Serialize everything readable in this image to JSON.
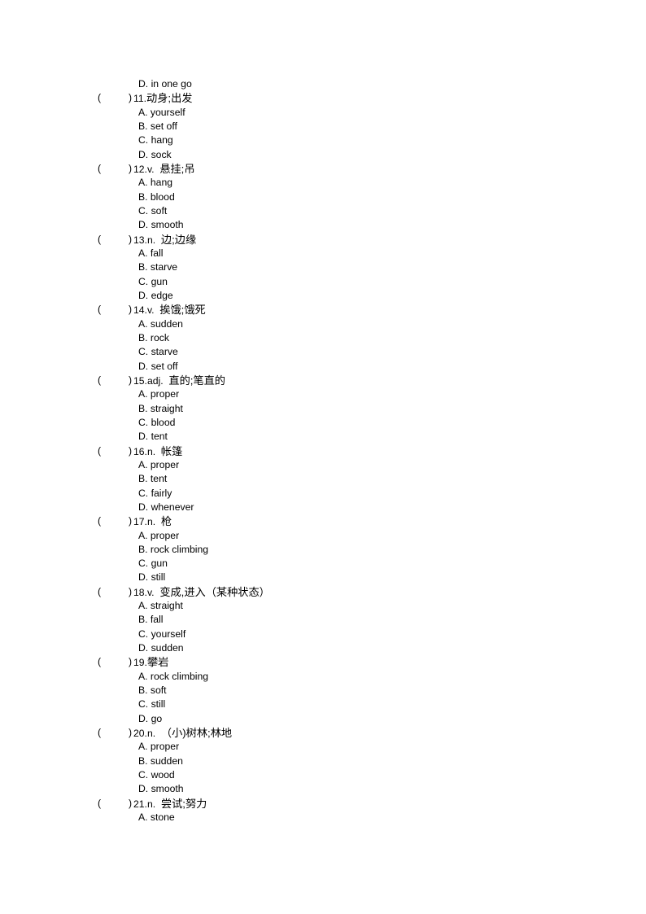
{
  "document": {
    "type": "vocabulary-multiple-choice-worksheet",
    "page_background": "#ffffff",
    "text_color": "#000000",
    "orphan_option": "D. in one go",
    "paren_open": "(",
    "paren_close": ")",
    "questions": [
      {
        "number": "11.",
        "pos": "",
        "prompt": "动身;出发",
        "options": [
          "A. yourself",
          "B. set off",
          "C. hang",
          "D. sock"
        ]
      },
      {
        "number": "12.",
        "pos": "v.",
        "prompt": "悬挂;吊",
        "options": [
          "A. hang",
          "B. blood",
          "C. soft",
          "D. smooth"
        ]
      },
      {
        "number": "13.",
        "pos": "n.",
        "prompt": "边;边缘",
        "options": [
          "A. fall",
          "B. starve",
          "C. gun",
          "D. edge"
        ]
      },
      {
        "number": "14.",
        "pos": "v.",
        "prompt": "挨饿;饿死",
        "options": [
          "A. sudden",
          "B. rock",
          "C. starve",
          "D. set off"
        ]
      },
      {
        "number": "15.",
        "pos": "adj.",
        "prompt": "直的;笔直的",
        "options": [
          "A. proper",
          "B. straight",
          "C. blood",
          "D. tent"
        ]
      },
      {
        "number": "16.",
        "pos": "n.",
        "prompt": "帐篷",
        "options": [
          "A. proper",
          "B. tent",
          "C. fairly",
          "D. whenever"
        ]
      },
      {
        "number": "17.",
        "pos": "n.",
        "prompt": "枪",
        "options": [
          "A. proper",
          "B. rock climbing",
          "C. gun",
          "D. still"
        ]
      },
      {
        "number": "18.",
        "pos": "v.",
        "prompt": "变成,进入（某种状态）",
        "options": [
          "A. straight",
          "B. fall",
          "C. yourself",
          "D. sudden"
        ]
      },
      {
        "number": "19.",
        "pos": "",
        "prompt": "攀岩",
        "options": [
          "A. rock climbing",
          "B. soft",
          "C. still",
          "D. go"
        ]
      },
      {
        "number": "20.",
        "pos": "n.",
        "prompt": "（小)树林;林地",
        "options": [
          "A. proper",
          "B. sudden",
          "C. wood",
          "D. smooth"
        ]
      },
      {
        "number": "21.",
        "pos": "n.",
        "prompt": "尝试;努力",
        "options": [
          "A. stone"
        ]
      }
    ]
  }
}
